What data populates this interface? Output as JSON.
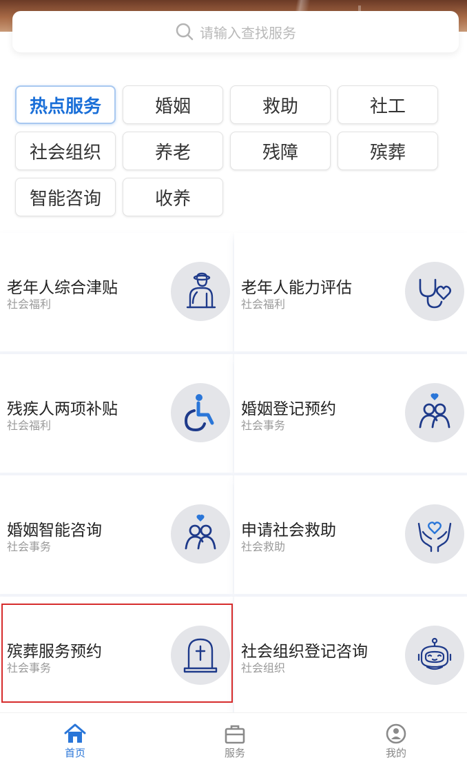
{
  "search": {
    "placeholder": "请输入查找服务"
  },
  "categories": [
    {
      "label": "热点服务",
      "active": true
    },
    {
      "label": "婚姻"
    },
    {
      "label": "救助"
    },
    {
      "label": "社工"
    },
    {
      "label": "社会组织"
    },
    {
      "label": "养老"
    },
    {
      "label": "残障"
    },
    {
      "label": "殡葬"
    },
    {
      "label": "智能咨询"
    },
    {
      "label": "收养"
    }
  ],
  "services": [
    {
      "title": "老年人综合津贴",
      "sub": "社会福利",
      "icon": "elderly-icon"
    },
    {
      "title": "老年人能力评估",
      "sub": "社会福利",
      "icon": "stethoscope-heart-icon"
    },
    {
      "title": "残疾人两项补贴",
      "sub": "社会福利",
      "icon": "wheelchair-icon"
    },
    {
      "title": "婚姻登记预约",
      "sub": "社会事务",
      "icon": "couple-heart-icon"
    },
    {
      "title": "婚姻智能咨询",
      "sub": "社会事务",
      "icon": "couple-heart-icon"
    },
    {
      "title": "申请社会救助",
      "sub": "社会救助",
      "icon": "hands-heart-icon"
    },
    {
      "title": "殡葬服务预约",
      "sub": "社会事务",
      "icon": "tombstone-icon"
    },
    {
      "title": "社会组织登记咨询",
      "sub": "社会组织",
      "icon": "robot-icon"
    }
  ],
  "nav": {
    "home": "首页",
    "services": "服务",
    "mine": "我的"
  },
  "colors": {
    "accent": "#2a76d8",
    "icon_navy": "#1e3a8a",
    "highlight": "#d62b2b"
  }
}
